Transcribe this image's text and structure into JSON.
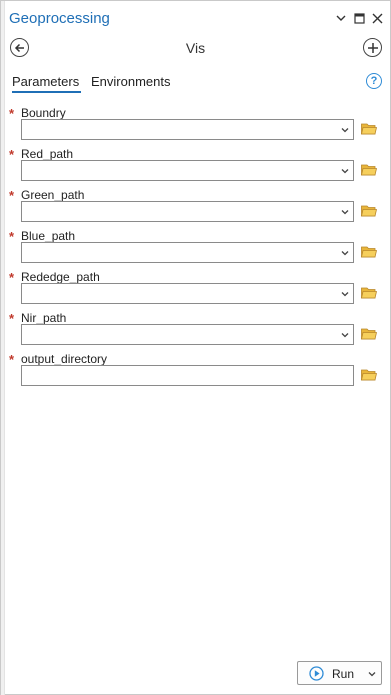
{
  "window": {
    "title": "Geoprocessing",
    "controls": [
      "chevron-down-icon",
      "restore-icon",
      "close-icon"
    ]
  },
  "tool": {
    "name": "Vis",
    "back_icon": "back-arrow-icon",
    "add_icon": "add-icon"
  },
  "tabs": [
    {
      "label": "Parameters",
      "active": true
    },
    {
      "label": "Environments",
      "active": false
    }
  ],
  "help_icon": "?",
  "params": [
    {
      "label": "Boundry",
      "required_mark": "*",
      "value": "",
      "dropdown": true
    },
    {
      "label": "Red_path",
      "required_mark": "*",
      "value": "",
      "dropdown": true
    },
    {
      "label": "Green_path",
      "required_mark": "*",
      "value": "",
      "dropdown": true
    },
    {
      "label": "Blue_path",
      "required_mark": "*",
      "value": "",
      "dropdown": true
    },
    {
      "label": "Rededge_path",
      "required_mark": "*",
      "value": "",
      "dropdown": true
    },
    {
      "label": "Nir_path",
      "required_mark": "*",
      "value": "",
      "dropdown": true
    },
    {
      "label": "output_directory",
      "required_mark": "*",
      "value": "",
      "dropdown": false
    }
  ],
  "run": {
    "label": "Run"
  },
  "colors": {
    "accent": "#1f6fb6",
    "required": "#c0392b",
    "folder": "#e8b53a",
    "help": "#2e8bd6"
  }
}
